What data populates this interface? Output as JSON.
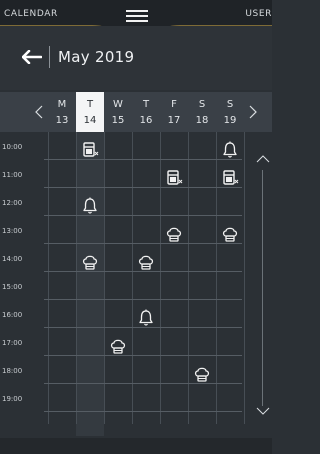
{
  "topbar": {
    "left_label": "CALENDAR",
    "right_label": "USER"
  },
  "header": {
    "month_title": "May 2019"
  },
  "week": {
    "days": [
      {
        "name": "M",
        "date": "13",
        "today": false
      },
      {
        "name": "T",
        "date": "14",
        "today": true
      },
      {
        "name": "W",
        "date": "15",
        "today": false
      },
      {
        "name": "T",
        "date": "16",
        "today": false
      },
      {
        "name": "F",
        "date": "17",
        "today": false
      },
      {
        "name": "S",
        "date": "18",
        "today": false
      },
      {
        "name": "S",
        "date": "19",
        "today": false
      }
    ]
  },
  "times": [
    "10:00",
    "11:00",
    "12:00",
    "13:00",
    "14:00",
    "15:00",
    "16:00",
    "17:00",
    "18:00",
    "19:00"
  ],
  "events": [
    {
      "type": "oven",
      "day": 1,
      "hour": "10:00"
    },
    {
      "type": "bell",
      "day": 6,
      "hour": "10:00"
    },
    {
      "type": "oven",
      "day": 4,
      "hour": "11:00"
    },
    {
      "type": "oven",
      "day": 6,
      "hour": "11:00"
    },
    {
      "type": "bell",
      "day": 1,
      "hour": "12:00"
    },
    {
      "type": "chef",
      "day": 4,
      "hour": "13:00"
    },
    {
      "type": "chef",
      "day": 6,
      "hour": "13:00"
    },
    {
      "type": "chef",
      "day": 1,
      "hour": "14:00"
    },
    {
      "type": "chef",
      "day": 3,
      "hour": "14:00"
    },
    {
      "type": "bell",
      "day": 3,
      "hour": "16:00"
    },
    {
      "type": "chef",
      "day": 2,
      "hour": "17:00"
    },
    {
      "type": "chef",
      "day": 5,
      "hour": "18:00"
    }
  ],
  "icons": {
    "menu": "hamburger-icon",
    "back": "arrow-left-icon",
    "prev": "chevron-left-icon",
    "next": "chevron-right-icon",
    "scroll_up": "chevron-up-icon",
    "scroll_down": "chevron-down-icon",
    "oven": "oven-icon",
    "bell": "bell-icon",
    "chef": "chef-hat-icon"
  },
  "colors": {
    "background": "#2b3035",
    "today": "#f4f5f6",
    "accent": "#c9a24a"
  }
}
